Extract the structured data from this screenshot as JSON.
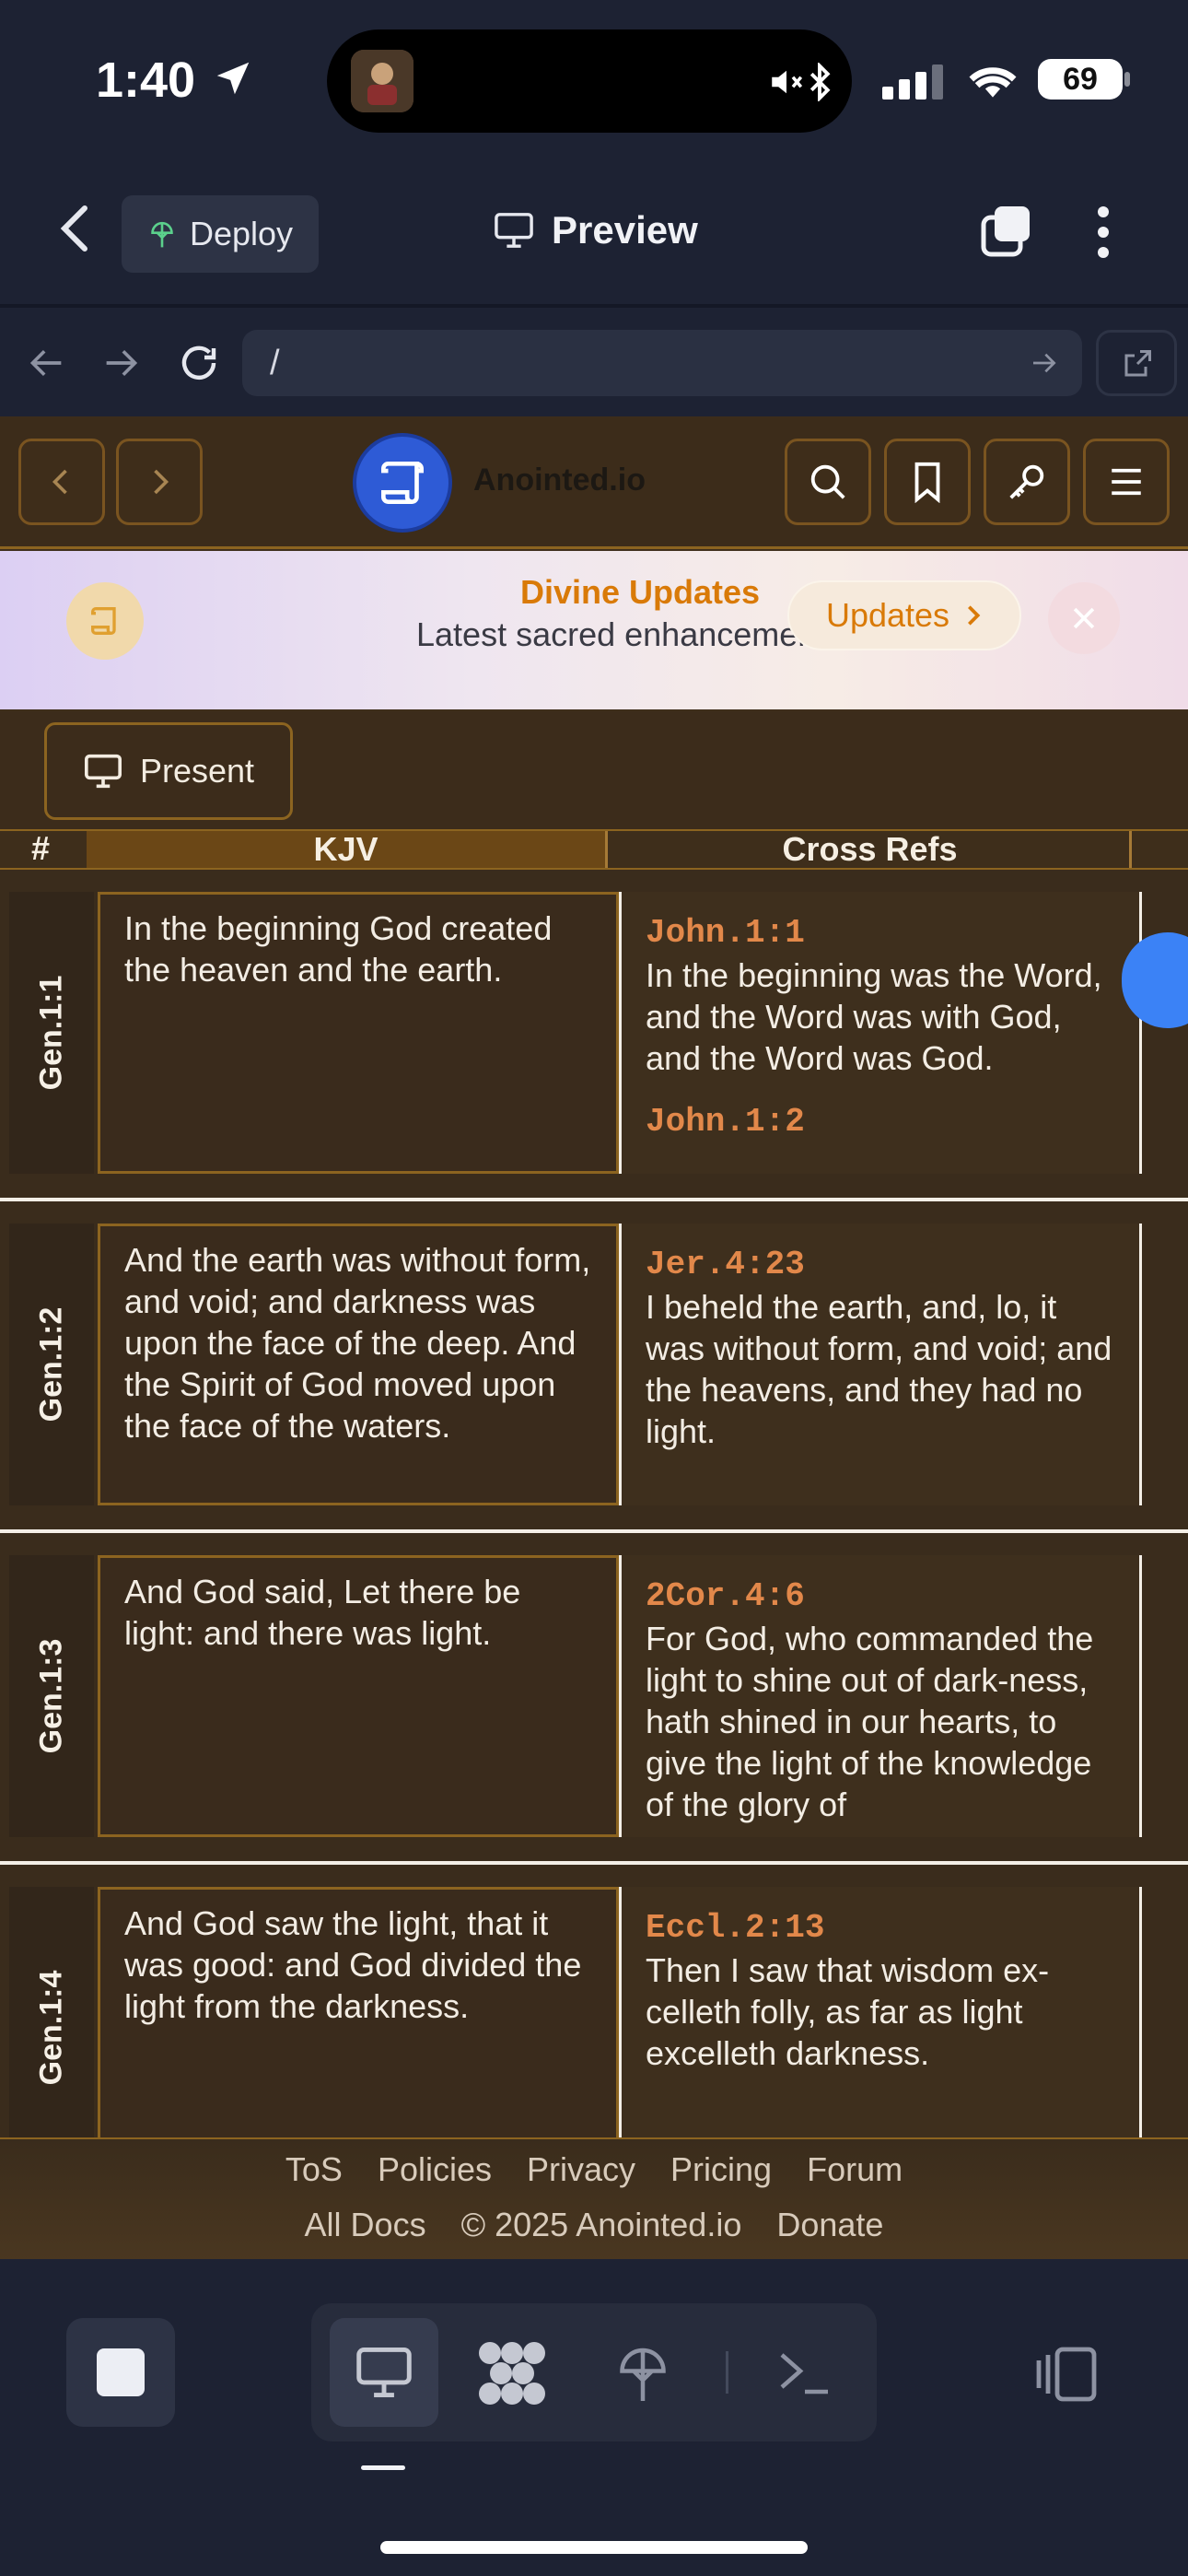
{
  "status_bar": {
    "time": "1:40",
    "battery": "69"
  },
  "app_header": {
    "deploy_label": "Deploy",
    "title": "Preview"
  },
  "url_bar": {
    "value": "/"
  },
  "site": {
    "brand": "Anointed.io",
    "banner": {
      "title": "Divine Updates",
      "subtitle": "Latest sacred enhancements",
      "button_label": "Updates"
    },
    "present_label": "Present",
    "table": {
      "headers": {
        "num": "#",
        "kjv": "KJV",
        "cross": "Cross Refs"
      },
      "rows": [
        {
          "ref": "Gen.1:1",
          "text": "In the beginning God created the heaven and the earth.",
          "cross_ref": "John.1:1",
          "cross_text": "In the beginning was the Word, and the Word was with God, and the Word was God.",
          "cross_ref_2": "John.1:2"
        },
        {
          "ref": "Gen.1:2",
          "text": "And the earth was without form, and void; and darkness was upon the face of the deep. And the Spirit of God moved upon the face of the waters.",
          "cross_ref": "Jer.4:23",
          "cross_text": "I beheld the earth, and, lo, it was without form, and void; and the heavens, and they had no light."
        },
        {
          "ref": "Gen.1:3",
          "text": "And God said, Let there be light: and there was light.",
          "cross_ref": "2Cor.4:6",
          "cross_text": "For God, who commanded the light to shine out of dark-ness, hath shined in our hearts, to give the light of the knowledge of the glory of"
        },
        {
          "ref": "Gen.1:4",
          "text": "And God saw the light, that it was good: and God divided the light from the darkness.",
          "cross_ref": "Eccl.2:13",
          "cross_text": "Then I saw that wisdom ex-celleth folly, as far as light excelleth darkness."
        }
      ]
    },
    "footer": {
      "links_row1": [
        "ToS",
        "Policies",
        "Privacy",
        "Pricing",
        "Forum"
      ],
      "links_row2": [
        "All Docs",
        "© 2025 Anointed.io",
        "Donate"
      ]
    }
  },
  "colors": {
    "accent": "#d97a08",
    "site_bg": "#3f2f1c",
    "app_bg": "#1d2233",
    "ref_color": "#e2884a",
    "logo_blue": "#2e5bd6"
  },
  "icons": [
    "location-arrow-icon",
    "mute-icon",
    "bluetooth-icon",
    "signal-icon",
    "wifi-icon",
    "back-chevron-icon",
    "cloud-deploy-icon",
    "monitor-icon",
    "copy-icon",
    "more-vertical-icon",
    "refresh-icon",
    "external-link-icon",
    "scroll-icon",
    "search-icon",
    "bookmark-icon",
    "key-icon",
    "menu-icon",
    "close-icon",
    "terminal-icon",
    "grid-icon"
  ]
}
